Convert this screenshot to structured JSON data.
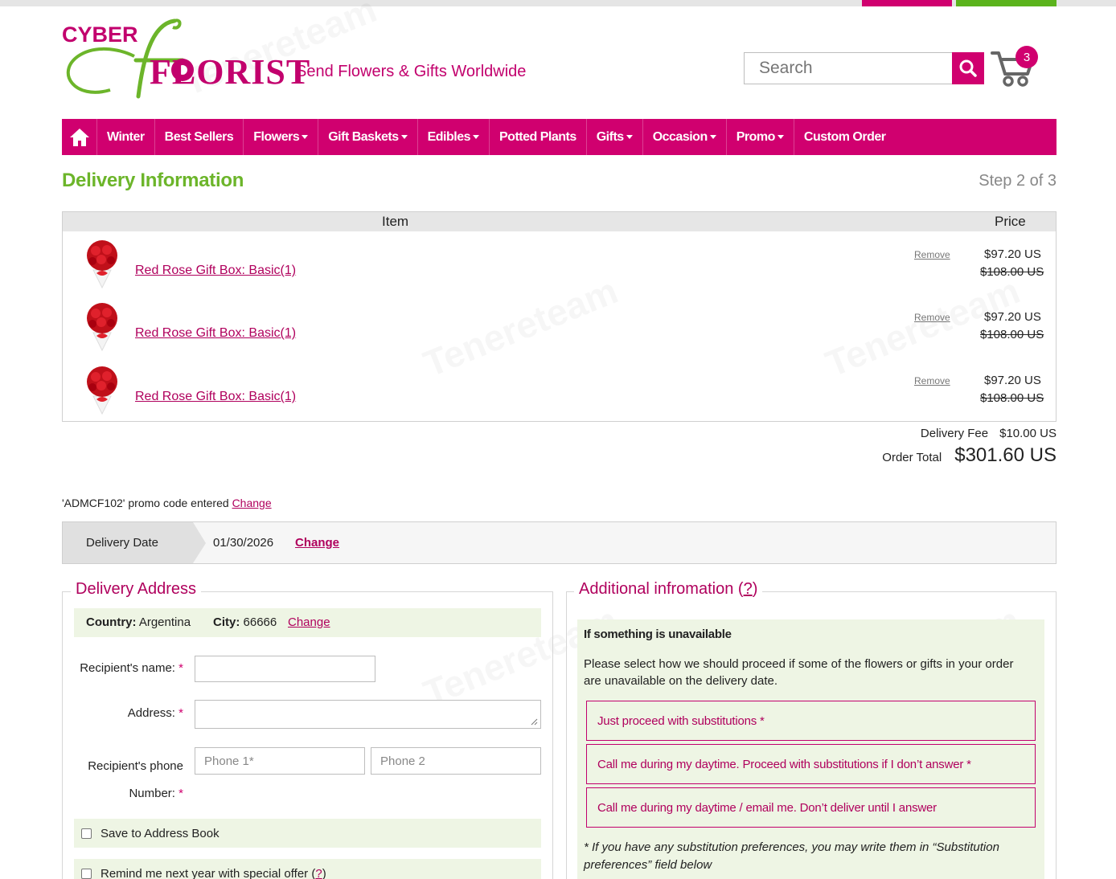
{
  "header": {
    "logo_text_top": "CYBER",
    "logo_text_bottom": "FLORIST",
    "tagline": "Send Flowers & Gifts Worldwide",
    "search_placeholder": "Search",
    "cart_count": "3"
  },
  "nav": {
    "items": [
      {
        "label": "Winter",
        "dropdown": false
      },
      {
        "label": "Best Sellers",
        "dropdown": false
      },
      {
        "label": "Flowers",
        "dropdown": true
      },
      {
        "label": "Gift Baskets",
        "dropdown": true
      },
      {
        "label": "Edibles",
        "dropdown": true
      },
      {
        "label": "Potted Plants",
        "dropdown": false
      },
      {
        "label": "Gifts",
        "dropdown": true
      },
      {
        "label": "Occasion",
        "dropdown": true
      },
      {
        "label": "Promo",
        "dropdown": true
      },
      {
        "label": "Custom Order",
        "dropdown": false
      }
    ]
  },
  "page": {
    "title": "Delivery Information",
    "step": "Step 2 of 3"
  },
  "order": {
    "col_item": "Item",
    "col_price": "Price",
    "remove_label": "Remove",
    "items": [
      {
        "name": "Red Rose Gift Box: Basic(1)",
        "price": "$97.20 US",
        "old_price": "$108.00 US"
      },
      {
        "name": "Red Rose Gift Box: Basic(1)",
        "price": "$97.20 US",
        "old_price": "$108.00 US"
      },
      {
        "name": "Red Rose Gift Box: Basic(1)",
        "price": "$97.20 US",
        "old_price": "$108.00 US"
      }
    ],
    "delivery_fee_label": "Delivery Fee",
    "delivery_fee": "$10.00 US",
    "total_label": "Order Total",
    "total": "$301.60 US"
  },
  "promo": {
    "text": "'ADMCF102' promo code entered",
    "change": "Change"
  },
  "delivery_date": {
    "label": "Delivery Date",
    "value": "01/30/2026",
    "change": "Change"
  },
  "address": {
    "legend": "Delivery Address",
    "country_label": "Country:",
    "country": "Argentina",
    "city_label": "City:",
    "city": "66666",
    "change": "Change",
    "recipient_name_label": "Recipient's name:",
    "address_label": "Address:",
    "phone_label_line1": "Recipient's phone",
    "phone_label_line2": "Number:",
    "required_mark": "*",
    "phone1_placeholder": "Phone 1*",
    "phone2_placeholder": "Phone 2",
    "save_label": "Save to Address Book",
    "remind_label": "Remind me next year with special offer",
    "remind_help": "?"
  },
  "additional": {
    "legend": "Additional infromation",
    "help": "?",
    "unavailable_title": "If something is unavailable",
    "unavailable_text": "Please select how we should proceed if some of the flowers or gifts in your order are unavailable on the delivery date.",
    "options": [
      "Just proceed with substitutions *",
      "Call me during my daytime. Proceed with substitutions if I don’t answer *",
      "Call me during my daytime / email me. Don’t deliver until I answer"
    ],
    "note": "* If you have any substitution preferences, you may write them in “Substitution preferences” field below"
  },
  "colors": {
    "brand_magenta": "#d0006f",
    "brand_green": "#6cb52a",
    "panel_green": "#eef5e4"
  }
}
